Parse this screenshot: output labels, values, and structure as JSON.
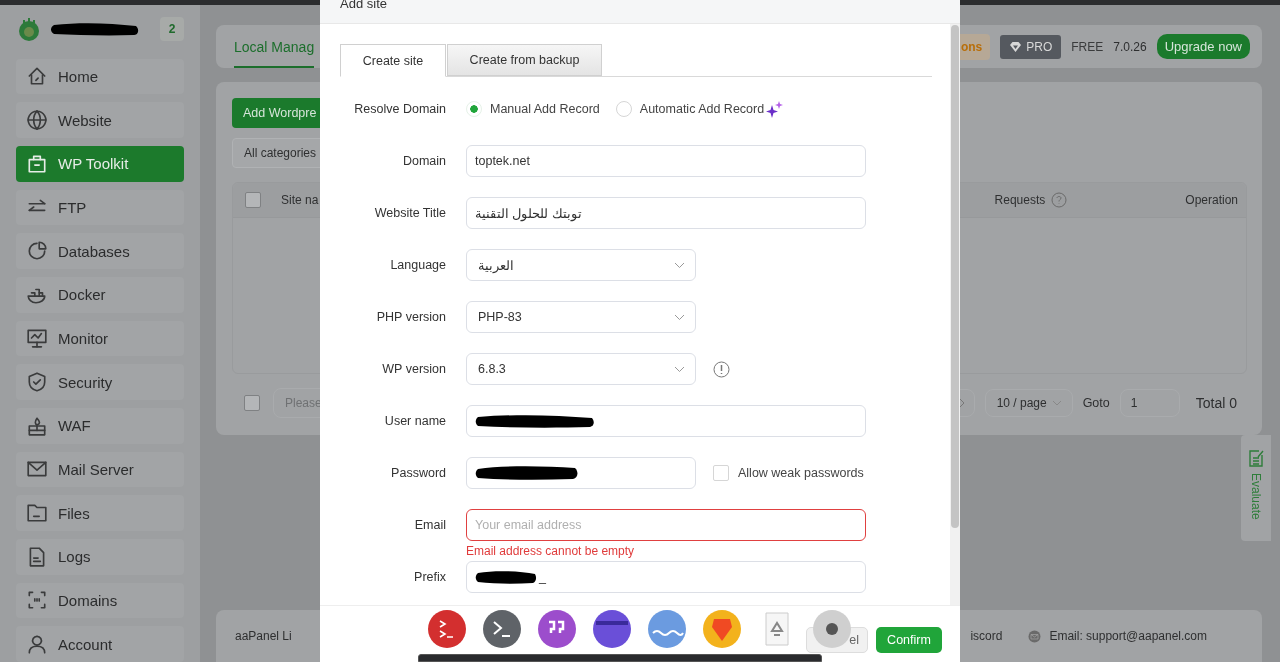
{
  "sidebar": {
    "badge": "2",
    "items": [
      {
        "label": "Home",
        "selected": false
      },
      {
        "label": "Website",
        "selected": false
      },
      {
        "label": "WP Toolkit",
        "selected": true
      },
      {
        "label": "FTP",
        "selected": false
      },
      {
        "label": "Databases",
        "selected": false
      },
      {
        "label": "Docker",
        "selected": false
      },
      {
        "label": "Monitor",
        "selected": false
      },
      {
        "label": "Security",
        "selected": false
      },
      {
        "label": "WAF",
        "selected": false
      },
      {
        "label": "Mail Server",
        "selected": false
      },
      {
        "label": "Files",
        "selected": false
      },
      {
        "label": "Logs",
        "selected": false
      },
      {
        "label": "Domains",
        "selected": false
      },
      {
        "label": "Account",
        "selected": false
      }
    ]
  },
  "header": {
    "tab": "Local Manag",
    "promo": "ons",
    "pro": "PRO",
    "edition": "FREE",
    "version": "7.0.26",
    "upgrade": "Upgrade now"
  },
  "toolbar": {
    "add_button": "Add Wordpre",
    "category": "All categories"
  },
  "table": {
    "select_all": {
      "checked": false
    },
    "columns": [
      "Site na",
      "Requests",
      "Operation"
    ]
  },
  "pagination": {
    "select_all": {
      "checked": false
    },
    "batch": "Please",
    "page_size": "10 / page",
    "goto": "Goto",
    "page": "1",
    "total": "Total 0"
  },
  "evaluate": "Evaluate",
  "footer": {
    "left": "aaPanel Li",
    "discord": "iscord",
    "email": "Email: support@aapanel.com"
  },
  "modal": {
    "title": "Add site",
    "tabs": [
      {
        "label": "Create site",
        "selected": true
      },
      {
        "label": "Create from backup",
        "selected": false
      }
    ],
    "resolve": {
      "label": "Resolve Domain",
      "options": [
        {
          "label": "Manual Add Record",
          "selected": true
        },
        {
          "label": "Automatic Add Record",
          "selected": false
        }
      ]
    },
    "fields": [
      {
        "kind": "text",
        "label": "Domain",
        "value": "toptek.net"
      },
      {
        "kind": "text",
        "label": "Website Title",
        "value": "توبتك للحلول التقنية"
      },
      {
        "kind": "select",
        "label": "Language",
        "value": "العربية"
      },
      {
        "kind": "select",
        "label": "PHP version",
        "value": "PHP-83"
      },
      {
        "kind": "select",
        "label": "WP version",
        "value": "6.8.3",
        "info": true
      },
      {
        "kind": "redacted",
        "label": "User name"
      },
      {
        "kind": "password",
        "label": "Password",
        "checkbox": {
          "label": "Allow weak passwords",
          "checked": false
        }
      },
      {
        "kind": "text",
        "label": "Email",
        "placeholder": "Your email address",
        "error": "Email address cannot be empty"
      },
      {
        "kind": "redacted",
        "label": "Prefix",
        "value": "_"
      }
    ],
    "cancel": "el",
    "confirm": "Confirm"
  }
}
